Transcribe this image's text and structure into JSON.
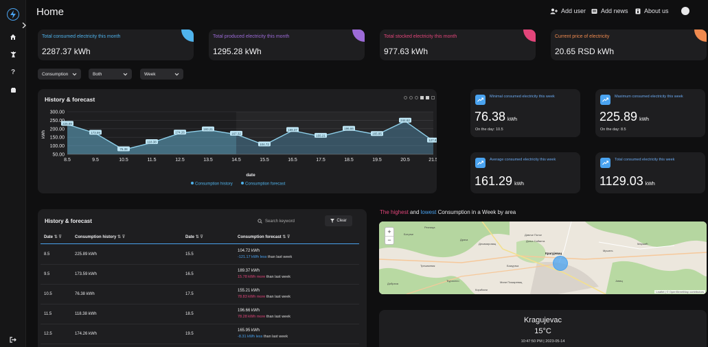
{
  "app": {
    "title": "Home"
  },
  "topbar": {
    "add_user": "Add user",
    "add_news": "Add news",
    "about_us": "About us"
  },
  "colors": {
    "blue": "#4fb3ec",
    "purple": "#9d6bd8",
    "pink": "#e2457a",
    "orange": "#f08a4f",
    "accent": "#4aa3f0"
  },
  "kpis": [
    {
      "label": "Total consumed electricity this month",
      "value": "2287.37 kWh",
      "color": "#4fb3ec"
    },
    {
      "label": "Total produced electricity this month",
      "value": "1295.28 kWh",
      "color": "#9d6bd8"
    },
    {
      "label": "Total stocked electricity this month",
      "value": "977.63 kWh",
      "color": "#e2457a"
    },
    {
      "label": "Current price of electricity",
      "value": "20.65 RSD kWh",
      "color": "#f08a4f"
    }
  ],
  "filters": {
    "type": "Consumption",
    "scope": "Both",
    "period": "Week"
  },
  "stats": [
    {
      "label": "Minimal consumed electricity this week",
      "value": "76.38",
      "unit": "kWh",
      "sub": "On the day: 10.5"
    },
    {
      "label": "Maximum consumed electricity this week",
      "value": "225.89",
      "unit": "kWh",
      "sub": "On the day: 8.5"
    },
    {
      "label": "Average consumed electricity this week",
      "value": "161.29",
      "unit": "kWh",
      "sub": ""
    },
    {
      "label": "Total consumed electricity this week",
      "value": "1129.03",
      "unit": "kWh",
      "sub": ""
    }
  ],
  "chart_data": {
    "type": "area",
    "title": "History & forecast",
    "xlabel": "date",
    "ylabel": "kWh",
    "x_ticks": [
      "8.5",
      "9.5",
      "10.5",
      "11.5",
      "12.5",
      "13.5",
      "14.5",
      "15.5",
      "16.5",
      "17.5",
      "18.5",
      "19.5",
      "20.5",
      "21.5"
    ],
    "y_ticks": [
      "300.00",
      "250.00",
      "200.00",
      "150.00",
      "100.00",
      "50.00"
    ],
    "ylim": [
      50,
      300
    ],
    "series": [
      {
        "name": "Consumption history",
        "x": [
          8.5,
          9.5,
          10.5,
          11.5,
          12.5,
          13.5,
          14.5
        ],
        "values": [
          225.89,
          173.59,
          76.38,
          118.38,
          174.26,
          193.21,
          167.32
        ]
      },
      {
        "name": "Consumption forecast",
        "x": [
          14.5,
          15.5,
          16.5,
          17.5,
          18.5,
          19.5,
          20.5,
          21.5
        ],
        "values": [
          167.32,
          104.72,
          189.37,
          155.21,
          196.66,
          165.95,
          244.62,
          127.81
        ]
      }
    ],
    "data_labels": [
      "225.89",
      "173.59",
      "76.38",
      "118.38",
      "174.26",
      "193.21",
      "167.32",
      "104.72",
      "189.37",
      "155.21",
      "196.66",
      "165.95",
      "244.62",
      "127.81"
    ],
    "legend_position": "bottom"
  },
  "table": {
    "title": "History & forecast",
    "search_placeholder": "Search keyword",
    "clear_label": "Clear",
    "headers": [
      "Date",
      "Consumption history",
      "Date",
      "Consumption forecast"
    ],
    "rows": [
      {
        "d1": "8.5",
        "h": "225.89 kWh",
        "d2": "15.5",
        "f": "104.72 kWh",
        "diff": "-121.17 kWh",
        "word": "less",
        "tail": "than last week",
        "color": "#4aa3f0"
      },
      {
        "d1": "9.5",
        "h": "173.59 kWh",
        "d2": "16.5",
        "f": "189.37 kWh",
        "diff": "15.78 kWh",
        "word": "more",
        "tail": "than last week",
        "color": "#e2457a"
      },
      {
        "d1": "10.5",
        "h": "76.38 kWh",
        "d2": "17.5",
        "f": "155.21 kWh",
        "diff": "78.83 kWh",
        "word": "more",
        "tail": "than last week",
        "color": "#e2457a"
      },
      {
        "d1": "11.5",
        "h": "118.38 kWh",
        "d2": "18.5",
        "f": "196.66 kWh",
        "diff": "78.28 kWh",
        "word": "more",
        "tail": "than last week",
        "color": "#e2457a"
      },
      {
        "d1": "12.5",
        "h": "174.26 kWh",
        "d2": "19.5",
        "f": "165.95 kWh",
        "diff": "-8.31 kWh",
        "word": "less",
        "tail": "than last week",
        "color": "#4aa3f0"
      }
    ]
  },
  "area_title": {
    "part1": "The highest",
    "part2": "and",
    "part3": "lowest",
    "part4": "Consumption in a Week by area"
  },
  "map": {
    "places": [
      "Резница",
      "Ботуње",
      "Десимировац",
      "Дивље Поље",
      "Драча",
      "Крагујевац",
      "Добрача",
      "Ђурисело",
      "Мали Пожаревац",
      "Корићани",
      "Мршељ",
      "Јовац",
      "Божурња",
      "Доња Сабанта",
      "Маршић",
      "Трешњевак"
    ],
    "attribution": "Leaflet | © OpenStreetMap contributors",
    "zoom_in": "+",
    "zoom_out": "−"
  },
  "weather": {
    "city": "Kragujevac",
    "temp": "15°C",
    "datetime": "10:47:50 PM | 2023-05-14"
  }
}
